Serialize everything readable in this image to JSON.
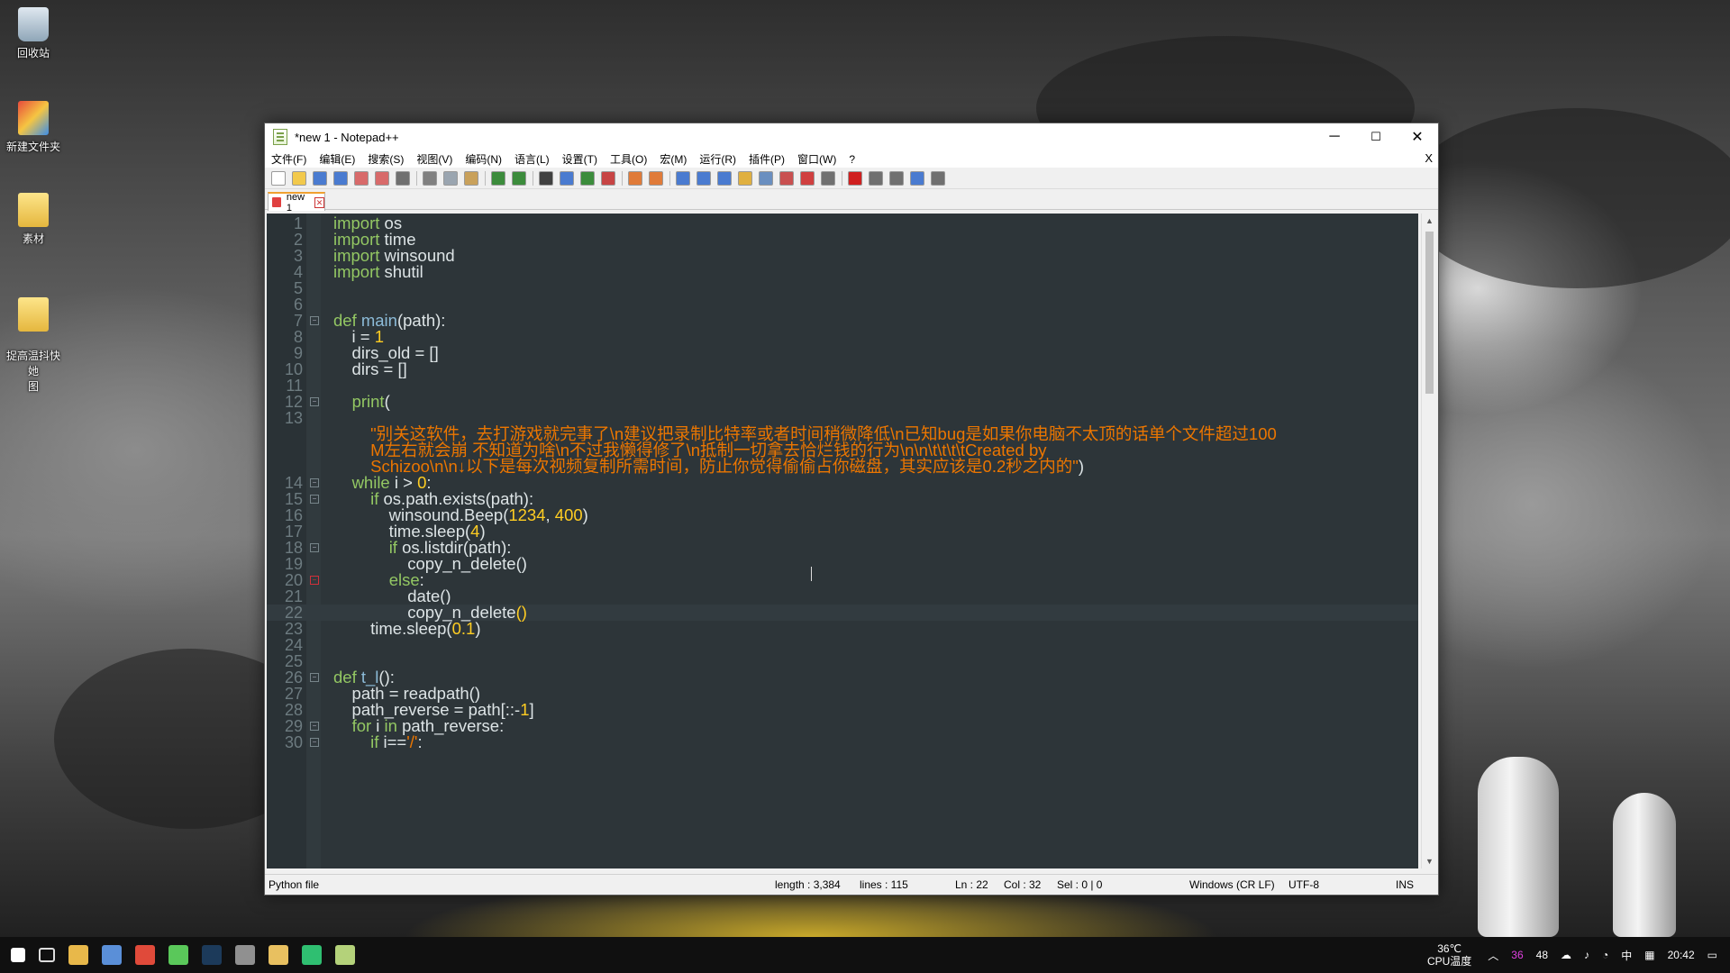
{
  "desktop": {
    "icons": [
      {
        "label": "回收站",
        "kind": "bin"
      },
      {
        "label": "新建文件夹",
        "kind": "app"
      },
      {
        "label": "素材",
        "kind": "folder"
      },
      {
        "label": "捉高温抖快她\n图",
        "kind": "folder"
      }
    ]
  },
  "window": {
    "title": "*new 1 - Notepad++",
    "controls": {
      "minimize": "─",
      "maximize": "☐",
      "close": "✕"
    }
  },
  "menu": {
    "items": [
      "文件(F)",
      "编辑(E)",
      "搜索(S)",
      "视图(V)",
      "编码(N)",
      "语言(L)",
      "设置(T)",
      "工具(O)",
      "宏(M)",
      "运行(R)",
      "插件(P)",
      "窗口(W)",
      "?"
    ],
    "close": "X"
  },
  "toolbar": {
    "icons": [
      "new-file-icon",
      "open-file-icon",
      "save-icon",
      "save-all-icon",
      "close-icon",
      "close-all-icon",
      "print-icon",
      "cut-icon",
      "copy-icon",
      "paste-icon",
      "undo-icon",
      "redo-icon",
      "find-icon",
      "replace-icon",
      "zoom-in-icon",
      "zoom-out-icon",
      "sync-v-icon",
      "sync-h-icon",
      "word-wrap-icon",
      "show-all-chars-icon",
      "indent-guide-icon",
      "udl-icon",
      "doc-map-icon",
      "function-list-icon",
      "folder-workspace-icon",
      "monitor-icon",
      "record-macro-icon",
      "stop-macro-icon",
      "play-macro-icon",
      "run-macro-multiple-icon",
      "save-macro-icon"
    ]
  },
  "tab": {
    "label": "new 1",
    "close": "✕"
  },
  "editor": {
    "lines": [
      {
        "n": "1",
        "tokens": [
          {
            "t": "import",
            "c": "kw"
          },
          {
            "t": " os",
            "c": ""
          }
        ]
      },
      {
        "n": "2",
        "tokens": [
          {
            "t": "import",
            "c": "kw"
          },
          {
            "t": " time",
            "c": ""
          }
        ]
      },
      {
        "n": "3",
        "tokens": [
          {
            "t": "import",
            "c": "kw"
          },
          {
            "t": " winsound",
            "c": ""
          }
        ]
      },
      {
        "n": "4",
        "tokens": [
          {
            "t": "import",
            "c": "kw"
          },
          {
            "t": " shutil",
            "c": ""
          }
        ]
      },
      {
        "n": "5",
        "tokens": []
      },
      {
        "n": "6",
        "tokens": []
      },
      {
        "n": "7",
        "fold": "minus",
        "tokens": [
          {
            "t": "def",
            "c": "kw"
          },
          {
            "t": " ",
            "c": ""
          },
          {
            "t": "main",
            "c": "fn"
          },
          {
            "t": "(path):",
            "c": ""
          }
        ]
      },
      {
        "n": "8",
        "tokens": [
          {
            "t": "    i = ",
            "c": ""
          },
          {
            "t": "1",
            "c": "num"
          }
        ]
      },
      {
        "n": "9",
        "tokens": [
          {
            "t": "    dirs_old = []",
            "c": ""
          }
        ]
      },
      {
        "n": "10",
        "tokens": [
          {
            "t": "    dirs = []",
            "c": ""
          }
        ]
      },
      {
        "n": "11",
        "tokens": []
      },
      {
        "n": "12",
        "fold": "minus",
        "tokens": [
          {
            "t": "    ",
            "c": ""
          },
          {
            "t": "print",
            "c": "kw"
          },
          {
            "t": "(",
            "c": ""
          }
        ]
      },
      {
        "n": "13",
        "tokens": []
      },
      {
        "n": "",
        "tokens": [
          {
            "t": "        \"别关这软件，去打游戏就完事了\\n建议把录制比特率或者时间稍微降低\\n已知bug是如果你电脑不太顶的话单个文件超过100",
            "c": "str"
          }
        ]
      },
      {
        "n": "",
        "tokens": [
          {
            "t": "        M左右就会崩 不知道为啥\\n不过我懒得修了\\n抵制一切拿去恰烂钱的行为\\n\\n\\t\\t\\t\\tCreated by",
            "c": "str"
          }
        ]
      },
      {
        "n": "",
        "tokens": [
          {
            "t": "        Schizoo\\n\\n↓以下是每次视频复制所需时间，防止你觉得偷偷占你磁盘，其实应该是0.2秒之内的\"",
            "c": "str"
          },
          {
            "t": ")",
            "c": ""
          }
        ]
      },
      {
        "n": "14",
        "fold": "minus",
        "tokens": [
          {
            "t": "    ",
            "c": ""
          },
          {
            "t": "while",
            "c": "kw"
          },
          {
            "t": " i > ",
            "c": ""
          },
          {
            "t": "0",
            "c": "num"
          },
          {
            "t": ":",
            "c": ""
          }
        ]
      },
      {
        "n": "15",
        "fold": "minus",
        "tokens": [
          {
            "t": "        ",
            "c": ""
          },
          {
            "t": "if",
            "c": "kw"
          },
          {
            "t": " os.path.exists(path):",
            "c": ""
          }
        ]
      },
      {
        "n": "16",
        "tokens": [
          {
            "t": "            winsound.Beep(",
            "c": ""
          },
          {
            "t": "1234",
            "c": "num"
          },
          {
            "t": ", ",
            "c": ""
          },
          {
            "t": "400",
            "c": "num"
          },
          {
            "t": ")",
            "c": ""
          }
        ]
      },
      {
        "n": "17",
        "tokens": [
          {
            "t": "            time.sleep(",
            "c": ""
          },
          {
            "t": "4",
            "c": "num"
          },
          {
            "t": ")",
            "c": ""
          }
        ]
      },
      {
        "n": "18",
        "fold": "minus",
        "tokens": [
          {
            "t": "            ",
            "c": ""
          },
          {
            "t": "if",
            "c": "kw"
          },
          {
            "t": " os.listdir(path):",
            "c": ""
          }
        ]
      },
      {
        "n": "19",
        "tokens": [
          {
            "t": "                copy_n_delete()",
            "c": ""
          }
        ]
      },
      {
        "n": "20",
        "fold": "minus-red",
        "tokens": [
          {
            "t": "            ",
            "c": ""
          },
          {
            "t": "else",
            "c": "kw"
          },
          {
            "t": ":",
            "c": ""
          }
        ]
      },
      {
        "n": "21",
        "tokens": [
          {
            "t": "                date()",
            "c": ""
          }
        ]
      },
      {
        "n": "22",
        "current": true,
        "tokens": [
          {
            "t": "                copy_n_delete",
            "c": ""
          },
          {
            "t": "()",
            "c": "num"
          }
        ]
      },
      {
        "n": "23",
        "tokens": [
          {
            "t": "        time.sleep(",
            "c": ""
          },
          {
            "t": "0.1",
            "c": "num"
          },
          {
            "t": ")",
            "c": ""
          }
        ]
      },
      {
        "n": "24",
        "tokens": []
      },
      {
        "n": "25",
        "tokens": []
      },
      {
        "n": "26",
        "fold": "minus",
        "tokens": [
          {
            "t": "def",
            "c": "kw"
          },
          {
            "t": " ",
            "c": ""
          },
          {
            "t": "t_l",
            "c": "fn"
          },
          {
            "t": "():",
            "c": ""
          }
        ]
      },
      {
        "n": "27",
        "tokens": [
          {
            "t": "    path = readpath()",
            "c": ""
          }
        ]
      },
      {
        "n": "28",
        "tokens": [
          {
            "t": "    path_reverse = path[::-",
            "c": ""
          },
          {
            "t": "1",
            "c": "num"
          },
          {
            "t": "]",
            "c": ""
          }
        ]
      },
      {
        "n": "29",
        "fold": "minus",
        "tokens": [
          {
            "t": "    ",
            "c": ""
          },
          {
            "t": "for",
            "c": "kw"
          },
          {
            "t": " i ",
            "c": ""
          },
          {
            "t": "in",
            "c": "kw"
          },
          {
            "t": " path_reverse:",
            "c": ""
          }
        ]
      },
      {
        "n": "30",
        "fold": "minus",
        "tokens": [
          {
            "t": "        ",
            "c": ""
          },
          {
            "t": "if",
            "c": "kw"
          },
          {
            "t": " i==",
            "c": ""
          },
          {
            "t": "'/'",
            "c": "str"
          },
          {
            "t": ":",
            "c": ""
          }
        ]
      }
    ]
  },
  "status": {
    "filetype": "Python file",
    "length": "length : 3,384",
    "lines": "lines : 115",
    "ln": "Ln : 22",
    "col": "Col : 32",
    "sel": "Sel : 0 | 0",
    "eol": "Windows (CR LF)",
    "encoding": "UTF-8",
    "mode": "INS"
  },
  "taskbar": {
    "apps": [
      "start-icon",
      "task-view-icon",
      "file-explorer-icon",
      "store-icon",
      "chrome-icon",
      "wechat-icon",
      "steam-icon",
      "obs-icon",
      "folder-icon",
      "pycharm-icon",
      "notepadpp-icon"
    ],
    "tray": {
      "temp": "36℃",
      "temp_label": "CPU温度",
      "badge1": "36",
      "badge2": "48",
      "ime": "中",
      "time": "20:42"
    }
  }
}
